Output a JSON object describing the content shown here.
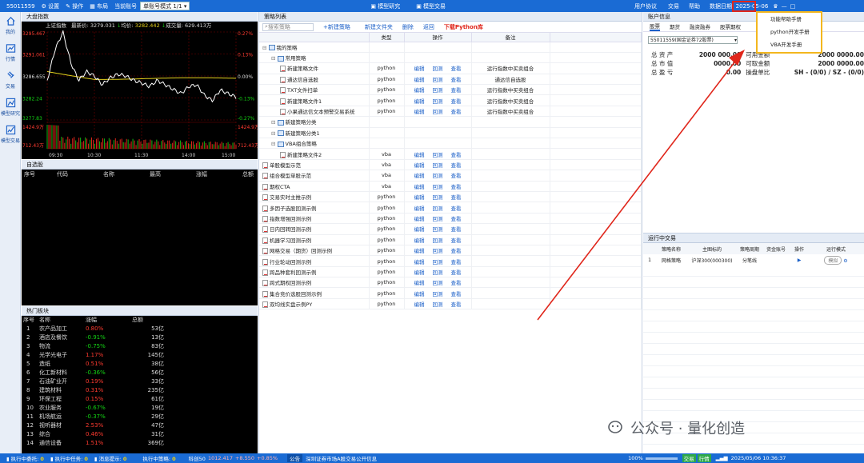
{
  "topbar": {
    "account": "55011559",
    "settings": "设置",
    "operate": "操作",
    "layout": "布局",
    "current_acct_label": "当前账号",
    "acct_mode": "单账号模式 1/1",
    "tab_research": "模型研究",
    "tab_trade": "模型交易",
    "user_agreement": "用户协议",
    "trade": "交易",
    "help": "帮助",
    "data_date": "数据日期: 2025-05-06"
  },
  "leftnav": {
    "items": [
      {
        "label": "我的",
        "icon": "home-icon"
      },
      {
        "label": "行情",
        "icon": "chart-icon"
      },
      {
        "label": "交易",
        "icon": "trade-icon"
      },
      {
        "label": "模型研究",
        "icon": "research-icon"
      },
      {
        "label": "模型交易",
        "icon": "model-trade-icon"
      }
    ]
  },
  "index": {
    "title": "大盘指数",
    "name": "上证指数",
    "latest_label": "最新价:",
    "latest": "3279.031",
    "avg_label": "均价:",
    "avg": "3282.442",
    "vol_label": "成交量:",
    "vol": "629.413万",
    "left_ticks": [
      "3295.467",
      "3291.061",
      "3286.655",
      "3282.24",
      "3277.83",
      "1424.9万",
      "712.43万"
    ],
    "right_ticks": [
      "0.27%",
      "0.13%",
      "0.00%",
      "-0.13%",
      "-0.27%",
      "1424.9万",
      "712.43万"
    ],
    "times": [
      "09:30",
      "10:30",
      "11:30",
      "14:00",
      "15:00"
    ],
    "colors": {
      "price": "#ffffff",
      "avg": "#e6d21c",
      "up": "#e0261b",
      "down": "#14b814"
    }
  },
  "watch": {
    "title": "自选股",
    "headers": [
      "序号",
      "代码",
      "名称",
      "最高",
      "涨幅",
      "总额"
    ]
  },
  "hot": {
    "title": "热门板块",
    "headers": [
      "序号",
      "名称",
      "涨幅",
      "总额"
    ],
    "rows": [
      [
        "1",
        "农产品加工",
        "0.80%",
        "53亿"
      ],
      [
        "2",
        "酒店及餐饮",
        "-0.91%",
        "13亿"
      ],
      [
        "3",
        "物流",
        "-0.75%",
        "83亿"
      ],
      [
        "4",
        "光学光电子",
        "1.17%",
        "145亿"
      ],
      [
        "5",
        "造纸",
        "0.51%",
        "38亿"
      ],
      [
        "6",
        "化工新材料",
        "-0.36%",
        "56亿"
      ],
      [
        "7",
        "石油矿业开",
        "0.19%",
        "33亿"
      ],
      [
        "8",
        "建筑材料",
        "0.31%",
        "235亿"
      ],
      [
        "9",
        "环保工程",
        "0.15%",
        "61亿"
      ],
      [
        "10",
        "农业服务",
        "-0.67%",
        "19亿"
      ],
      [
        "11",
        "机场航运",
        "-0.37%",
        "29亿"
      ],
      [
        "12",
        "视听器材",
        "2.53%",
        "47亿"
      ],
      [
        "13",
        "综合",
        "0.46%",
        "31亿"
      ],
      [
        "14",
        "通信设备",
        "1.51%",
        "369亿"
      ]
    ]
  },
  "strategy": {
    "title": "策略列表",
    "search_placeholder": "搜索策略",
    "new_strategy": "+新建策略",
    "new_folder": "新建文件夹",
    "delete": "删除",
    "back": "返回",
    "download": "下载Python库",
    "headers": [
      "",
      "类型",
      "操作",
      "备注"
    ],
    "op_edit": "编辑",
    "op_backtest": "回测",
    "op_view": "查看",
    "rows": [
      {
        "indent": 0,
        "kind": "root",
        "name": "我的策略",
        "type": "",
        "ops": false,
        "note": ""
      },
      {
        "indent": 1,
        "kind": "folder",
        "name": "常用策略",
        "type": "",
        "ops": false,
        "note": ""
      },
      {
        "indent": 2,
        "kind": "doc",
        "name": "新建策略文件",
        "type": "python",
        "ops": true,
        "note": "运行指数中买卖组合"
      },
      {
        "indent": 2,
        "kind": "doc",
        "name": "通达信自选股",
        "type": "python",
        "ops": true,
        "note": "通达信自选股"
      },
      {
        "indent": 2,
        "kind": "doc",
        "name": "TXT文件扫单",
        "type": "python",
        "ops": true,
        "note": "运行指数中买卖组合"
      },
      {
        "indent": 2,
        "kind": "doc",
        "name": "新建策略文件1",
        "type": "python",
        "ops": true,
        "note": "运行指数中买卖组合"
      },
      {
        "indent": 2,
        "kind": "doc",
        "name": "小果通达信文本预警交易系统",
        "type": "python",
        "ops": true,
        "note": "运行指数中买卖组合"
      },
      {
        "indent": 1,
        "kind": "folder",
        "name": "新建策略分类",
        "type": "",
        "ops": false,
        "note": ""
      },
      {
        "indent": 1,
        "kind": "folder",
        "name": "新建策略分类1",
        "type": "",
        "ops": false,
        "note": ""
      },
      {
        "indent": 1,
        "kind": "folder",
        "name": "VBA组合策略",
        "type": "",
        "ops": false,
        "note": ""
      },
      {
        "indent": 2,
        "kind": "doc",
        "name": "新建策略文件2",
        "type": "vba",
        "ops": true,
        "note": ""
      },
      {
        "indent": 0,
        "kind": "doc",
        "name": "单股模型示范",
        "type": "vba",
        "ops": true,
        "note": ""
      },
      {
        "indent": 0,
        "kind": "doc",
        "name": "组合模型单股示范",
        "type": "vba",
        "ops": true,
        "note": ""
      },
      {
        "indent": 0,
        "kind": "doc",
        "name": "期权CTA",
        "type": "vba",
        "ops": true,
        "note": ""
      },
      {
        "indent": 0,
        "kind": "doc",
        "name": "交易实时主推示例",
        "type": "python",
        "ops": true,
        "note": ""
      },
      {
        "indent": 0,
        "kind": "doc",
        "name": "多因子选股回测示例",
        "type": "python",
        "ops": true,
        "note": ""
      },
      {
        "indent": 0,
        "kind": "doc",
        "name": "指数增强回测示例",
        "type": "python",
        "ops": true,
        "note": ""
      },
      {
        "indent": 0,
        "kind": "doc",
        "name": "日内回转回测示例",
        "type": "python",
        "ops": true,
        "note": ""
      },
      {
        "indent": 0,
        "kind": "doc",
        "name": "机器学习回测示例",
        "type": "python",
        "ops": true,
        "note": ""
      },
      {
        "indent": 0,
        "kind": "doc",
        "name": "网格交易（期货）回测示例",
        "type": "python",
        "ops": true,
        "note": ""
      },
      {
        "indent": 0,
        "kind": "doc",
        "name": "行业轮动回测示例",
        "type": "python",
        "ops": true,
        "note": ""
      },
      {
        "indent": 0,
        "kind": "doc",
        "name": "跨品种套利回测示例",
        "type": "python",
        "ops": true,
        "note": ""
      },
      {
        "indent": 0,
        "kind": "doc",
        "name": "跨式期权回测示例",
        "type": "python",
        "ops": true,
        "note": ""
      },
      {
        "indent": 0,
        "kind": "doc",
        "name": "集合竞价选股回测示例",
        "type": "python",
        "ops": true,
        "note": ""
      },
      {
        "indent": 0,
        "kind": "doc",
        "name": "双均线实盘示例PY",
        "type": "python",
        "ops": true,
        "note": ""
      }
    ]
  },
  "account": {
    "title": "账户信息",
    "tabs": [
      "股票",
      "期货",
      "融资融券",
      "股票期权"
    ],
    "acct_select": "55011559(国金证券72股票)",
    "rows": [
      [
        "总 资 产",
        "2000 000.00",
        "可用金额",
        "2000 0000.00"
      ],
      [
        "总 市 值",
        "0000.00",
        "可取金额",
        "2000 0000.00"
      ],
      [
        "总 盈 亏",
        "0.00",
        "操盘单比",
        "SH - (0/0) / SZ - (0/0)"
      ]
    ]
  },
  "running": {
    "title": "运行中交易",
    "headers": [
      "",
      "策略名称",
      "主图标的",
      "策略周期",
      "资金账号",
      "操作",
      "运行模式"
    ],
    "rows": [
      [
        "1",
        "网格策略",
        "沪深300(000300)",
        "分笔线",
        "",
        "",
        "模拟"
      ]
    ]
  },
  "helpmenu": {
    "items": [
      "功能帮助手册",
      "python开发手册",
      "VBA开发手册"
    ]
  },
  "statusbar": {
    "exec_order": "执行中委托",
    "exec_order_n": "0",
    "exec_task": "执行中任务",
    "exec_task_n": "0",
    "msg": "消息提示",
    "msg_n": "0",
    "exec_strategy": "执行中策略",
    "exec_strategy_n": "0",
    "idx_name": "科创50",
    "idx_val": "1012.417",
    "idx_chg": "+8.550",
    "idx_pct": "+0.85%",
    "notice_label": "公告",
    "notice": "深圳证券市场A股交易公开信息",
    "zoom": "100%",
    "trade": "交易",
    "quote": "行情",
    "datetime": "2025/05/06 10:36:37"
  },
  "watermark": {
    "text": "公众号 · 量化创造"
  }
}
